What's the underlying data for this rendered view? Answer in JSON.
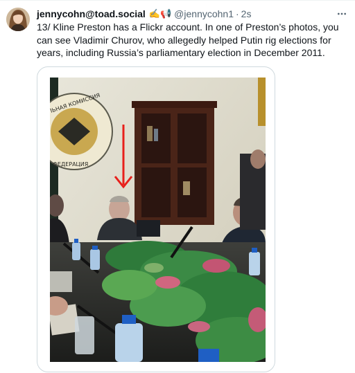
{
  "author": {
    "display_name": "jennycohn@toad.social",
    "emojis": "✍️📢",
    "handle": "@jennycohn1",
    "separator": "·",
    "time": "2s"
  },
  "tweet": {
    "text": "13/ Kline Preston has a Flickr account. In one of Preston’s photos, you can see Vladimir Churov, who allegedly helped Putin rig elections for years, including Russia’s parliamentary election in December 2011."
  },
  "media": {
    "seal_text_top": "ТЕЛЬНАЯ КОМИССИЯ",
    "seal_text_bottom": "ФЕДЕРАЦИЯ"
  },
  "icons": {
    "more": "more-horizontal-icon",
    "arrow": "red-down-arrow"
  },
  "colors": {
    "text": "#0f1419",
    "secondary": "#536471",
    "border": "#cfd9de",
    "arrow": "#e8201b"
  }
}
